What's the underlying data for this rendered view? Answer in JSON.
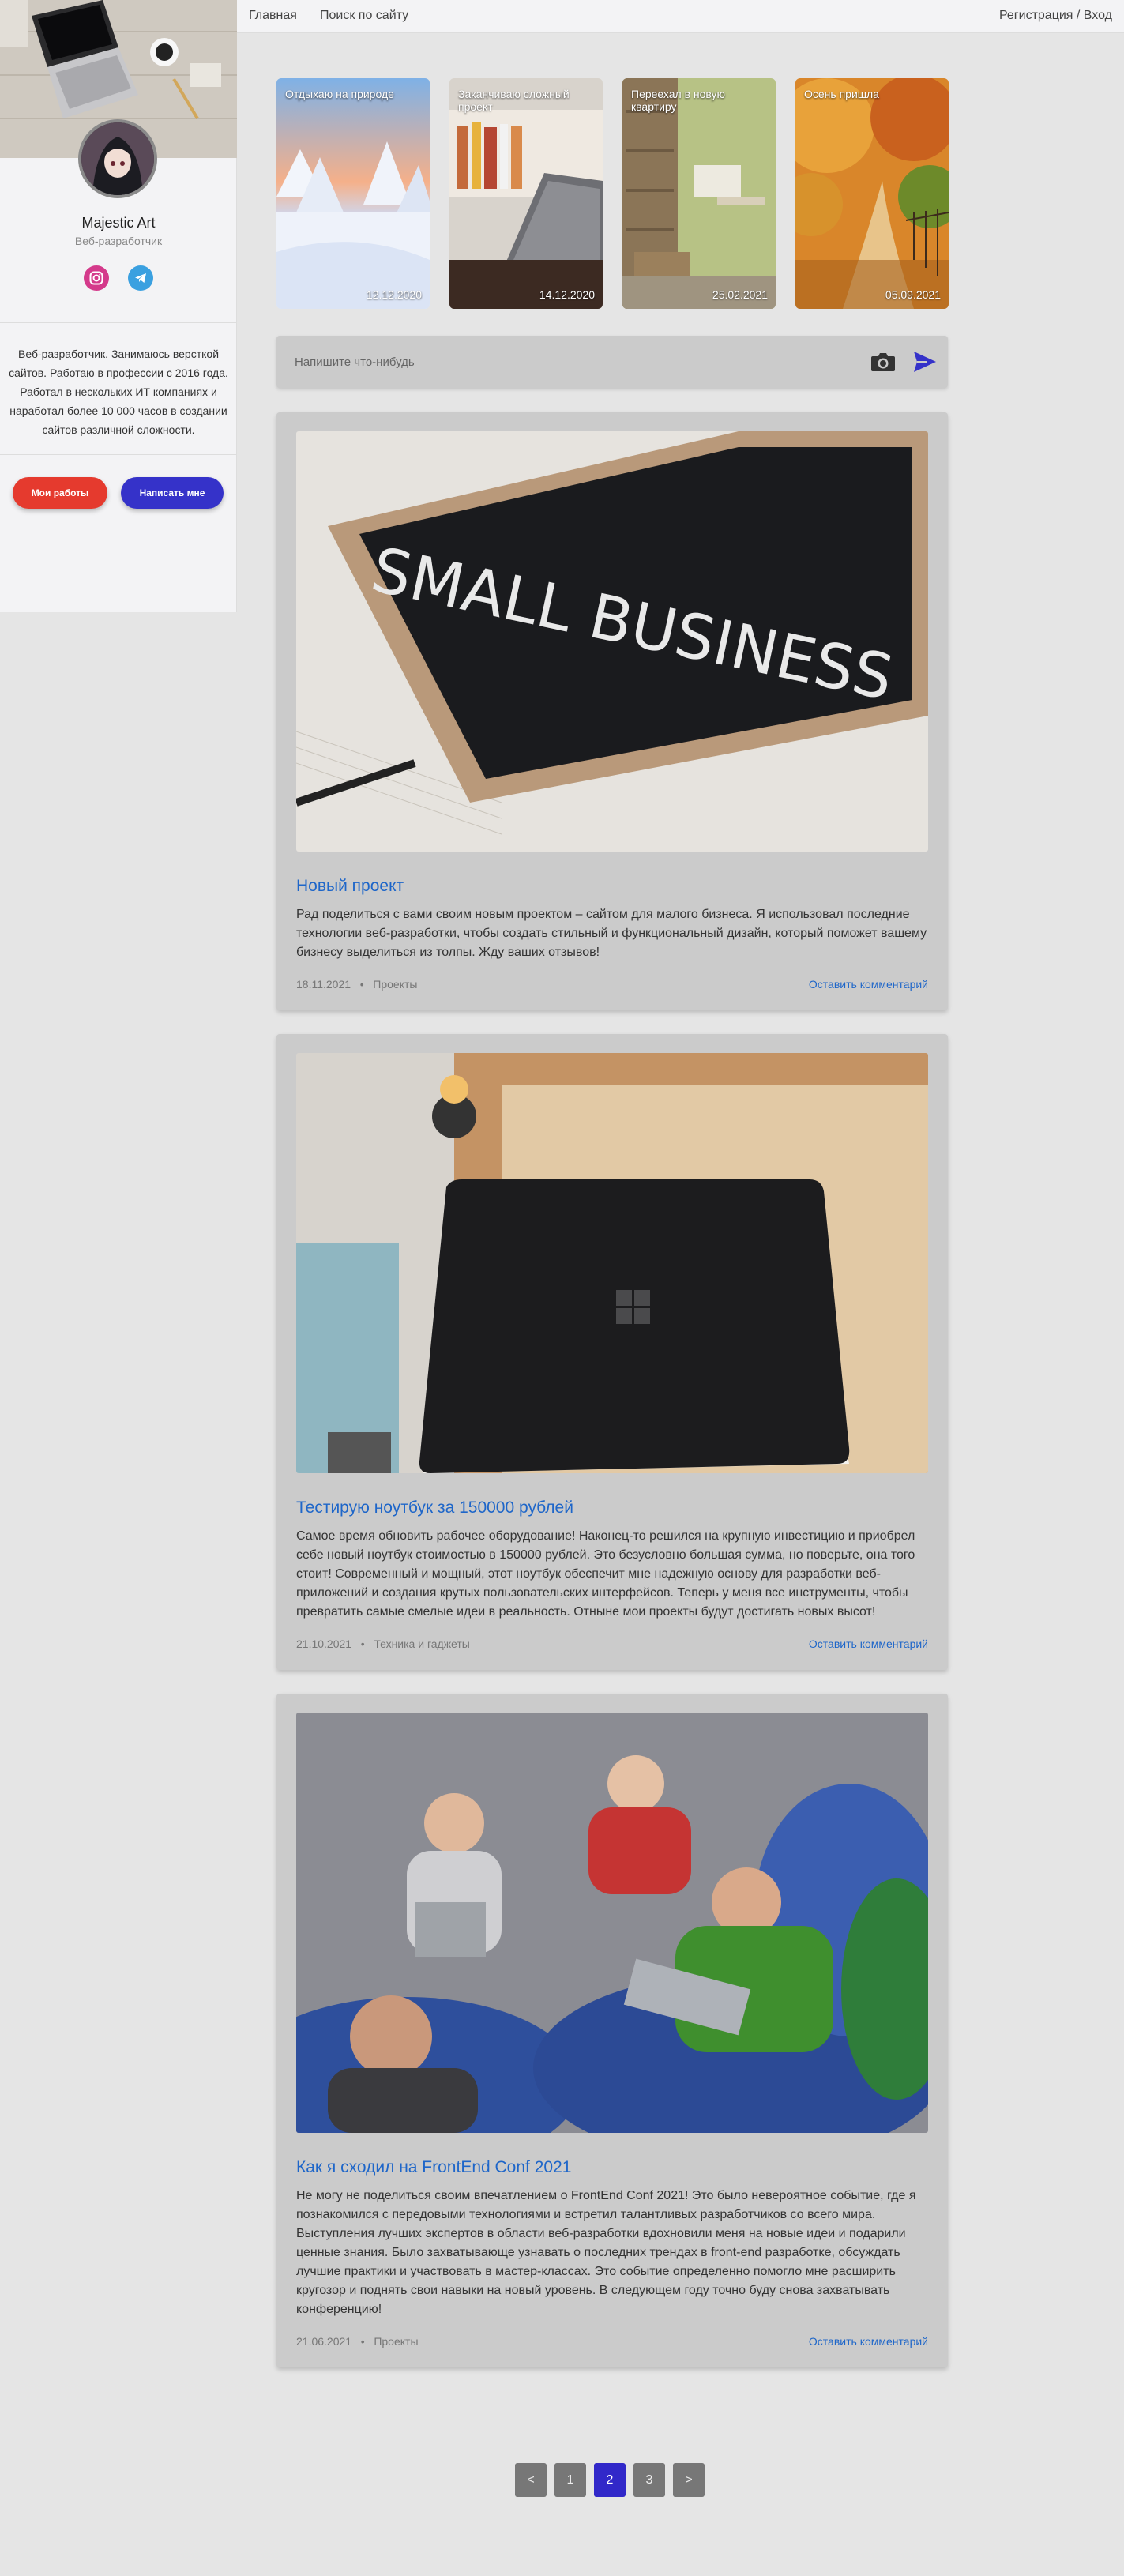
{
  "profile": {
    "name": "Majestic Art",
    "role": "Веб-разработчик",
    "bio": "Веб-разработчик. Занимаюсь версткой сайтов. Работаю в профессии с 2016 года. Работал в нескольких ИТ компаниях и наработал более 10 000 часов в создании сайтов различной сложности.",
    "buttons": {
      "works": "Мои работы",
      "contact": "Написать мне"
    }
  },
  "nav": {
    "home": "Главная",
    "search": "Поиск по сайту",
    "auth": "Регистрация / Вход"
  },
  "stories": [
    {
      "title": "Отдыхаю на природе",
      "date": "12.12.2020"
    },
    {
      "title": "Заканчиваю сложный проект",
      "date": "14.12.2020"
    },
    {
      "title": "Переехал в новую квартиру",
      "date": "25.02.2021"
    },
    {
      "title": "Осень пришла",
      "date": "05.09.2021"
    }
  ],
  "composer": {
    "placeholder": "Напишите что-нибудь"
  },
  "posts": [
    {
      "image_text": "SMALL BUSINESS",
      "title": "Новый проект",
      "text": "Рад поделиться с вами своим новым проектом – сайтом для малого бизнеса. Я использовал последние технологии веб-разработки, чтобы создать стильный и функциональный дизайн, который поможет вашему бизнесу выделиться из толпы. Жду ваших отзывов!",
      "date": "18.11.2021",
      "category": "Проекты",
      "comment": "Оставить комментарий"
    },
    {
      "title": "Тестирую ноутбук за 150000 рублей",
      "text": "Самое время обновить рабочее оборудование! Наконец-то решился на крупную инвестицию и приобрел себе новый ноутбук стоимостью в 150000 рублей. Это безусловно большая сумма, но поверьте, она того стоит! Современный и мощный, этот ноутбук обеспечит мне надежную основу для разработки веб-приложений и создания крутых пользовательских интерфейсов. Теперь у меня все инструменты, чтобы превратить самые смелые идеи в реальность. Отныне мои проекты будут достигать новых высот!",
      "date": "21.10.2021",
      "category": "Техника и гаджеты",
      "comment": "Оставить комментарий"
    },
    {
      "title": "Как я сходил на FrontEnd Conf 2021",
      "text": "Не могу не поделиться своим впечатлением о FrontEnd Conf 2021! Это было невероятное событие, где я познакомился с передовыми технологиями и встретил талантливых разработчиков со всего мира. Выступления лучших экспертов в области веб-разработки вдохновили меня на новые идеи и подарили ценные знания. Было захватывающе узнавать о последних трендах в front-end разработке, обсуждать лучшие практики и участвовать в мастер-классах. Это событие определенно помогло мне расширить кругозор и поднять свои навыки на новый уровень. В следующем году точно буду снова захватывать конференцию!",
      "date": "21.06.2021",
      "category": "Проекты",
      "comment": "Оставить комментарий"
    }
  ],
  "meta_separator": "•",
  "pagination": {
    "prev": "<",
    "pages": [
      "1",
      "2",
      "3"
    ],
    "active": "2",
    "next": ">"
  },
  "colors": {
    "accent_blue": "#3532c9",
    "accent_red": "#e53a2e",
    "link": "#1e66c9"
  },
  "icons": [
    "instagram-icon",
    "telegram-icon",
    "camera-icon",
    "send-icon"
  ]
}
